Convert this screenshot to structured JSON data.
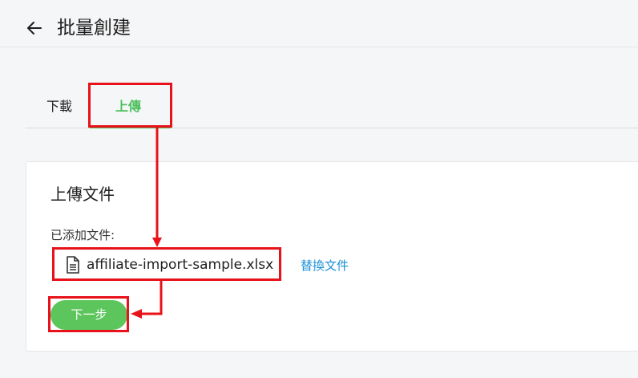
{
  "header": {
    "title": "批量創建",
    "back_icon": "arrow-left-icon"
  },
  "tabs": [
    {
      "label": "下載",
      "active": false
    },
    {
      "label": "上傳",
      "active": true
    }
  ],
  "upload_card": {
    "title": "上傳文件",
    "added_label": "已添加文件:",
    "file_icon": "document-icon",
    "file_name": "affiliate-import-sample.xlsx",
    "replace_label": "替換文件",
    "next_label": "下一步"
  },
  "colors": {
    "accent_green": "#4cbf5c",
    "button_green": "#5cc55b",
    "link_blue": "#1a8fd6",
    "annotation_red": "#e8121a"
  }
}
